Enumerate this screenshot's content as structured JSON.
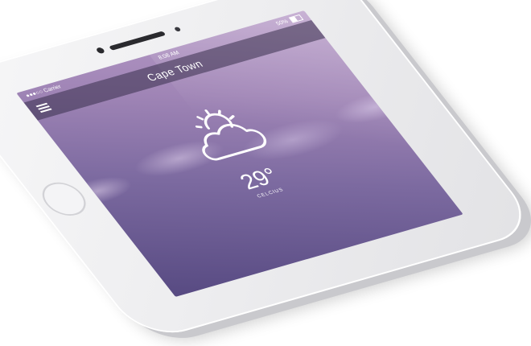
{
  "status_bar": {
    "carrier": "●●●○○ Carrier",
    "time": "8:08 AM",
    "battery": "50%"
  },
  "nav": {
    "city": "Cape Town"
  },
  "weather": {
    "temperature": "29°",
    "unit": "CELCIUS"
  },
  "colors": {
    "sky_top": "#b79ac7",
    "sky_bottom": "#574a82",
    "phone_body": "#eeeef0"
  }
}
